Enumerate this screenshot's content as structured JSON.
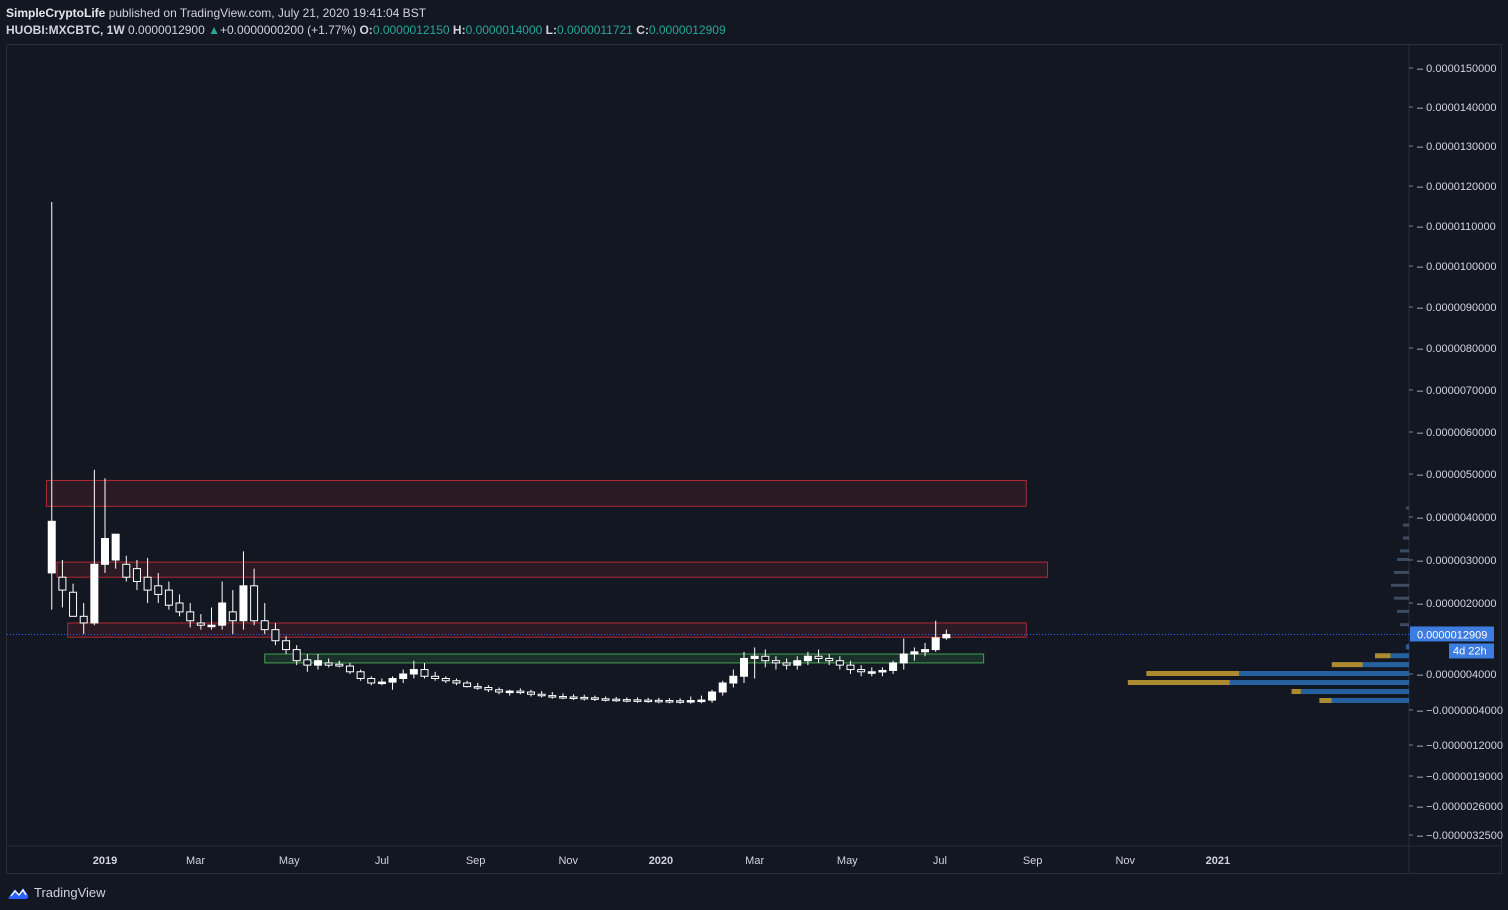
{
  "header": {
    "author": "SimpleCryptoLife",
    "published_text": "published on TradingView.com, July 21, 2020 19:41:04 BST",
    "symbol": "HUOBI:MXCBTC, 1W",
    "last_price": "0.0000012900",
    "change_arrow": "▲",
    "change": "+0.0000000200 (+1.77%)",
    "open_label": "O:",
    "open": "0.0000012150",
    "high_label": "H:",
    "high": "0.0000014000",
    "low_label": "L:",
    "low": "0.0000011721",
    "close_label": "C:",
    "close": "0.0000012909"
  },
  "footer": {
    "brand": "TradingView",
    "logo_icon": "tradingview-cloud-icon"
  },
  "colors": {
    "background": "#131722",
    "grid_border": "#2a2e39",
    "resistance_zone": "#b22833",
    "support_zone": "#3fa34d",
    "price_line": "#2962ff",
    "price_badge": "#3d7de0",
    "volume_profile_blue": "#2a6fb5",
    "volume_profile_gold": "#c8a032",
    "candle": "#ffffff"
  },
  "chart_data": {
    "type": "candlestick",
    "interval": "1W",
    "x_labels": [
      {
        "label": "2019",
        "x": 0
      },
      {
        "label": "Mar",
        "x": 8.5
      },
      {
        "label": "May",
        "x": 17.3
      },
      {
        "label": "Jul",
        "x": 26
      },
      {
        "label": "Sep",
        "x": 34.8
      },
      {
        "label": "Nov",
        "x": 43.5
      },
      {
        "label": "2020",
        "x": 52.2
      },
      {
        "label": "Mar",
        "x": 61
      },
      {
        "label": "May",
        "x": 69.7
      },
      {
        "label": "Jul",
        "x": 78.4
      },
      {
        "label": "Sep",
        "x": 87.1
      },
      {
        "label": "Nov",
        "x": 95.8
      },
      {
        "label": "2021",
        "x": 104.5
      }
    ],
    "y_ticks": [
      "0.0000150000",
      "0.0000140000",
      "0.0000130000",
      "0.0000120000",
      "0.0000110000",
      "0.0000100000",
      "0.0000090000",
      "0.0000080000",
      "0.0000070000",
      "0.0000060000",
      "0.0000050000",
      "0.0000040000",
      "0.0000030000",
      "0.0000020000",
      "0.0000004000",
      "−0.0000004000",
      "−0.0000012000",
      "−0.0000019000",
      "−0.0000026000",
      "−0.0000032500"
    ],
    "y_tick_values": [
      1.5e-05,
      1.4e-05,
      1.3e-05,
      1.2e-05,
      1.1e-05,
      1e-05,
      9e-06,
      8e-06,
      7e-06,
      6e-06,
      5e-06,
      4e-06,
      3e-06,
      2e-06,
      4e-07,
      -4e-07,
      -1.2e-06,
      -1.9e-06,
      -2.6e-06,
      -3.25e-06
    ],
    "current_price_label": "0.0000012909",
    "current_price": 1.2909e-06,
    "countdown_label": "4d 22h",
    "candles": [
      {
        "w": -5,
        "o": 2.7e-06,
        "h": 1.16e-05,
        "l": 1.85e-06,
        "c": 3.9e-06
      },
      {
        "w": -4,
        "o": 2.6e-06,
        "h": 3e-06,
        "l": 1.9e-06,
        "c": 2.3e-06
      },
      {
        "w": -3,
        "o": 2.25e-06,
        "h": 2.45e-06,
        "l": 1.7e-06,
        "c": 1.7e-06
      },
      {
        "w": -2,
        "o": 1.7e-06,
        "h": 2e-06,
        "l": 1.3e-06,
        "c": 1.55e-06
      },
      {
        "w": -1,
        "o": 1.55e-06,
        "h": 5.1e-06,
        "l": 1.5e-06,
        "c": 2.9e-06
      },
      {
        "w": 0,
        "o": 2.9e-06,
        "h": 4.9e-06,
        "l": 2.7e-06,
        "c": 3.5e-06
      },
      {
        "w": 1,
        "o": 3e-06,
        "h": 3.6e-06,
        "l": 2.8e-06,
        "c": 3.6e-06
      },
      {
        "w": 2,
        "o": 2.9e-06,
        "h": 3.1e-06,
        "l": 2.5e-06,
        "c": 2.6e-06
      },
      {
        "w": 3,
        "o": 2.8e-06,
        "h": 3e-06,
        "l": 2.3e-06,
        "c": 2.5e-06
      },
      {
        "w": 4,
        "o": 2.6e-06,
        "h": 3.05e-06,
        "l": 2e-06,
        "c": 2.3e-06
      },
      {
        "w": 5,
        "o": 2.4e-06,
        "h": 2.7e-06,
        "l": 2e-06,
        "c": 2.2e-06
      },
      {
        "w": 6,
        "o": 2.3e-06,
        "h": 2.5e-06,
        "l": 1.85e-06,
        "c": 1.95e-06
      },
      {
        "w": 7,
        "o": 2e-06,
        "h": 2.2e-06,
        "l": 1.7e-06,
        "c": 1.8e-06
      },
      {
        "w": 8,
        "o": 1.8e-06,
        "h": 2e-06,
        "l": 1.45e-06,
        "c": 1.6e-06
      },
      {
        "w": 9,
        "o": 1.55e-06,
        "h": 1.75e-06,
        "l": 1.4e-06,
        "c": 1.5e-06
      },
      {
        "w": 10,
        "o": 1.5e-06,
        "h": 1.9e-06,
        "l": 1.4e-06,
        "c": 1.5e-06
      },
      {
        "w": 11,
        "o": 1.5e-06,
        "h": 2.5e-06,
        "l": 1.4e-06,
        "c": 2e-06
      },
      {
        "w": 12,
        "o": 1.8e-06,
        "h": 2.3e-06,
        "l": 1.3e-06,
        "c": 1.6e-06
      },
      {
        "w": 13,
        "o": 1.6e-06,
        "h": 3.2e-06,
        "l": 1.4e-06,
        "c": 2.4e-06
      },
      {
        "w": 14,
        "o": 2.4e-06,
        "h": 2.8e-06,
        "l": 1.5e-06,
        "c": 1.6e-06
      },
      {
        "w": 15,
        "o": 1.6e-06,
        "h": 2e-06,
        "l": 1.3e-06,
        "c": 1.4e-06
      },
      {
        "w": 16,
        "o": 1.4e-06,
        "h": 1.55e-06,
        "l": 1.05e-06,
        "c": 1.15e-06
      },
      {
        "w": 17,
        "o": 1.15e-06,
        "h": 1.25e-06,
        "l": 8.5e-07,
        "c": 9.5e-07
      },
      {
        "w": 18,
        "o": 9.5e-07,
        "h": 1.05e-06,
        "l": 6e-07,
        "c": 7e-07
      },
      {
        "w": 19,
        "o": 7.2e-07,
        "h": 8.5e-07,
        "l": 4.5e-07,
        "c": 6e-07
      },
      {
        "w": 20,
        "o": 6e-07,
        "h": 8.5e-07,
        "l": 5e-07,
        "c": 7e-07
      },
      {
        "w": 21,
        "o": 6.5e-07,
        "h": 7.5e-07,
        "l": 5.5e-07,
        "c": 6e-07
      },
      {
        "w": 22,
        "o": 6.2e-07,
        "h": 7e-07,
        "l": 5.5e-07,
        "c": 5.8e-07
      },
      {
        "w": 23,
        "o": 5.8e-07,
        "h": 6.5e-07,
        "l": 4e-07,
        "c": 4.5e-07
      },
      {
        "w": 24,
        "o": 4.5e-07,
        "h": 5e-07,
        "l": 2.5e-07,
        "c": 3e-07
      },
      {
        "w": 25,
        "o": 3e-07,
        "h": 3.5e-07,
        "l": 1.5e-07,
        "c": 2e-07
      },
      {
        "w": 26,
        "o": 2e-07,
        "h": 3e-07,
        "l": 1.5e-07,
        "c": 2.2e-07
      },
      {
        "w": 27,
        "o": 2.2e-07,
        "h": 3.5e-07,
        "l": 5e-08,
        "c": 3e-07
      },
      {
        "w": 28,
        "o": 3e-07,
        "h": 5e-07,
        "l": 2e-07,
        "c": 4e-07
      },
      {
        "w": 29,
        "o": 4e-07,
        "h": 7e-07,
        "l": 3e-07,
        "c": 5e-07
      },
      {
        "w": 30,
        "o": 5e-07,
        "h": 6.5e-07,
        "l": 3e-07,
        "c": 3.5e-07
      },
      {
        "w": 31,
        "o": 3.5e-07,
        "h": 4.5e-07,
        "l": 2.5e-07,
        "c": 3e-07
      },
      {
        "w": 32,
        "o": 3e-07,
        "h": 3.5e-07,
        "l": 2e-07,
        "c": 2.5e-07
      },
      {
        "w": 33,
        "o": 2.5e-07,
        "h": 3e-07,
        "l": 1.5e-07,
        "c": 2e-07
      },
      {
        "w": 34,
        "o": 2e-07,
        "h": 2.5e-07,
        "l": 1e-07,
        "c": 1.2e-07
      },
      {
        "w": 35,
        "o": 1.2e-07,
        "h": 2e-07,
        "l": 5e-08,
        "c": 1e-07
      },
      {
        "w": 36,
        "o": 1e-07,
        "h": 1.5e-07,
        "l": 0,
        "c": 5e-08
      },
      {
        "w": 37,
        "o": 5e-08,
        "h": 1e-07,
        "l": -5e-08,
        "c": 0
      },
      {
        "w": 38,
        "o": 0,
        "h": 5e-08,
        "l": -8e-08,
        "c": 2e-08
      },
      {
        "w": 39,
        "o": 2e-08,
        "h": 8e-08,
        "l": -5e-08,
        "c": 0
      },
      {
        "w": 40,
        "o": 0,
        "h": 5e-08,
        "l": -1e-07,
        "c": -5e-08
      },
      {
        "w": 41,
        "o": -5e-08,
        "h": 2e-08,
        "l": -1.2e-07,
        "c": -8e-08
      },
      {
        "w": 42,
        "o": -8e-08,
        "h": 0,
        "l": -1.5e-07,
        "c": -1e-07
      },
      {
        "w": 43,
        "o": -1e-07,
        "h": -3e-08,
        "l": -1.6e-07,
        "c": -1.1e-07
      },
      {
        "w": 44,
        "o": -1.1e-07,
        "h": -5e-08,
        "l": -1.8e-07,
        "c": -1.2e-07
      },
      {
        "w": 45,
        "o": -1.2e-07,
        "h": -6e-08,
        "l": -1.9e-07,
        "c": -1.3e-07
      },
      {
        "w": 46,
        "o": -1.3e-07,
        "h": -8e-08,
        "l": -2e-07,
        "c": -1.5e-07
      },
      {
        "w": 47,
        "o": -1.5e-07,
        "h": -1e-07,
        "l": -2.1e-07,
        "c": -1.6e-07
      },
      {
        "w": 48,
        "o": -1.6e-07,
        "h": -1.1e-07,
        "l": -2.2e-07,
        "c": -1.7e-07
      },
      {
        "w": 49,
        "o": -1.7e-07,
        "h": -1.2e-07,
        "l": -2.3e-07,
        "c": -1.75e-07
      },
      {
        "w": 50,
        "o": -1.75e-07,
        "h": -1.2e-07,
        "l": -2.4e-07,
        "c": -1.8e-07
      },
      {
        "w": 51,
        "o": -1.8e-07,
        "h": -1.3e-07,
        "l": -2.4e-07,
        "c": -1.85e-07
      },
      {
        "w": 52,
        "o": -1.85e-07,
        "h": -1.3e-07,
        "l": -2.5e-07,
        "c": -1.9e-07
      },
      {
        "w": 53,
        "o": -1.9e-07,
        "h": -1.4e-07,
        "l": -2.5e-07,
        "c": -1.95e-07
      },
      {
        "w": 54,
        "o": -1.95e-07,
        "h": -1.4e-07,
        "l": -2.6e-07,
        "c": -2e-07
      },
      {
        "w": 55,
        "o": -2e-07,
        "h": -1e-07,
        "l": -2.6e-07,
        "c": -1.9e-07
      },
      {
        "w": 56,
        "o": -1.9e-07,
        "h": -8e-08,
        "l": -2.5e-07,
        "c": -1.8e-07
      },
      {
        "w": 57,
        "o": -1.8e-07,
        "h": 5e-08,
        "l": -2.4e-07,
        "c": 0
      },
      {
        "w": 58,
        "o": 0,
        "h": 2.5e-07,
        "l": -8e-08,
        "c": 2e-07
      },
      {
        "w": 59,
        "o": 2e-07,
        "h": 5e-07,
        "l": 1e-07,
        "c": 3.5e-07
      },
      {
        "w": 60,
        "o": 3.5e-07,
        "h": 9e-07,
        "l": 2e-07,
        "c": 7.5e-07
      },
      {
        "w": 61,
        "o": 7.5e-07,
        "h": 1e-06,
        "l": 3e-07,
        "c": 8e-07
      },
      {
        "w": 62,
        "o": 8e-07,
        "h": 9.5e-07,
        "l": 5.5e-07,
        "c": 7e-07
      },
      {
        "w": 63,
        "o": 7e-07,
        "h": 8e-07,
        "l": 5e-07,
        "c": 6.5e-07
      },
      {
        "w": 64,
        "o": 6.5e-07,
        "h": 7.5e-07,
        "l": 5e-07,
        "c": 6e-07
      },
      {
        "w": 65,
        "o": 6e-07,
        "h": 8e-07,
        "l": 5e-07,
        "c": 7e-07
      },
      {
        "w": 66,
        "o": 7e-07,
        "h": 9e-07,
        "l": 6e-07,
        "c": 8e-07
      },
      {
        "w": 67,
        "o": 8e-07,
        "h": 9.5e-07,
        "l": 6.5e-07,
        "c": 7.5e-07
      },
      {
        "w": 68,
        "o": 7.5e-07,
        "h": 8.5e-07,
        "l": 6e-07,
        "c": 7e-07
      },
      {
        "w": 69,
        "o": 7e-07,
        "h": 8e-07,
        "l": 5e-07,
        "c": 6e-07
      },
      {
        "w": 70,
        "o": 6e-07,
        "h": 7e-07,
        "l": 4e-07,
        "c": 5e-07
      },
      {
        "w": 71,
        "o": 5e-07,
        "h": 6e-07,
        "l": 3.5e-07,
        "c": 4.5e-07
      },
      {
        "w": 72,
        "o": 4.5e-07,
        "h": 5.5e-07,
        "l": 3.5e-07,
        "c": 4.5e-07
      },
      {
        "w": 73,
        "o": 4.5e-07,
        "h": 5.5e-07,
        "l": 3.5e-07,
        "c": 4.8e-07
      },
      {
        "w": 74,
        "o": 4.8e-07,
        "h": 7e-07,
        "l": 4e-07,
        "c": 6.5e-07
      },
      {
        "w": 75,
        "o": 6.5e-07,
        "h": 1.2e-06,
        "l": 5e-07,
        "c": 8.5e-07
      },
      {
        "w": 76,
        "o": 8.5e-07,
        "h": 1e-06,
        "l": 7e-07,
        "c": 9e-07
      },
      {
        "w": 77,
        "o": 9e-07,
        "h": 1.1e-06,
        "l": 8e-07,
        "c": 9.5e-07
      },
      {
        "w": 78,
        "o": 9.5e-07,
        "h": 1.6e-06,
        "l": 9e-07,
        "c": 1.215e-06
      },
      {
        "w": 79,
        "o": 1.215e-06,
        "h": 1.4e-06,
        "l": 1.1721e-06,
        "c": 1.2909e-06
      }
    ],
    "zones": [
      {
        "kind": "resistance",
        "top": 4.85e-06,
        "bottom": 4.25e-06,
        "w_start": -5.5,
        "w_end": 86.5
      },
      {
        "kind": "resistance",
        "top": 2.95e-06,
        "bottom": 2.6e-06,
        "w_start": -4.5,
        "w_end": 88.5
      },
      {
        "kind": "resistance",
        "top": 1.55e-06,
        "bottom": 1.23e-06,
        "w_start": -3.5,
        "w_end": 86.5
      },
      {
        "kind": "support",
        "top": 8.5e-07,
        "bottom": 6.5e-07,
        "w_start": 15,
        "w_end": 82.5
      }
    ],
    "volume_profile_note": "horizontal volume profile on right edge",
    "volume_profile": [
      {
        "y": 1e-06,
        "blue": 0.01,
        "gold": 0
      },
      {
        "y": 8e-07,
        "blue": 0.06,
        "gold": 0.05
      },
      {
        "y": 6e-07,
        "blue": 0.15,
        "gold": 0.1
      },
      {
        "y": 4e-07,
        "blue": 0.55,
        "gold": 0.3
      },
      {
        "y": 2e-07,
        "blue": 0.58,
        "gold": 0.33
      },
      {
        "y": 0,
        "blue": 0.35,
        "gold": 0.03
      },
      {
        "y": -2e-07,
        "blue": 0.25,
        "gold": 0.04
      }
    ],
    "small_profile": [
      {
        "y": 4.2e-06,
        "w": 0.01
      },
      {
        "y": 3.8e-06,
        "w": 0.02
      },
      {
        "y": 3.5e-06,
        "w": 0.02
      },
      {
        "y": 3.2e-06,
        "w": 0.03
      },
      {
        "y": 3e-06,
        "w": 0.04
      },
      {
        "y": 2.7e-06,
        "w": 0.05
      },
      {
        "y": 2.4e-06,
        "w": 0.06
      },
      {
        "y": 2.1e-06,
        "w": 0.05
      },
      {
        "y": 1.8e-06,
        "w": 0.04
      },
      {
        "y": 1.5e-06,
        "w": 0.03
      }
    ]
  }
}
